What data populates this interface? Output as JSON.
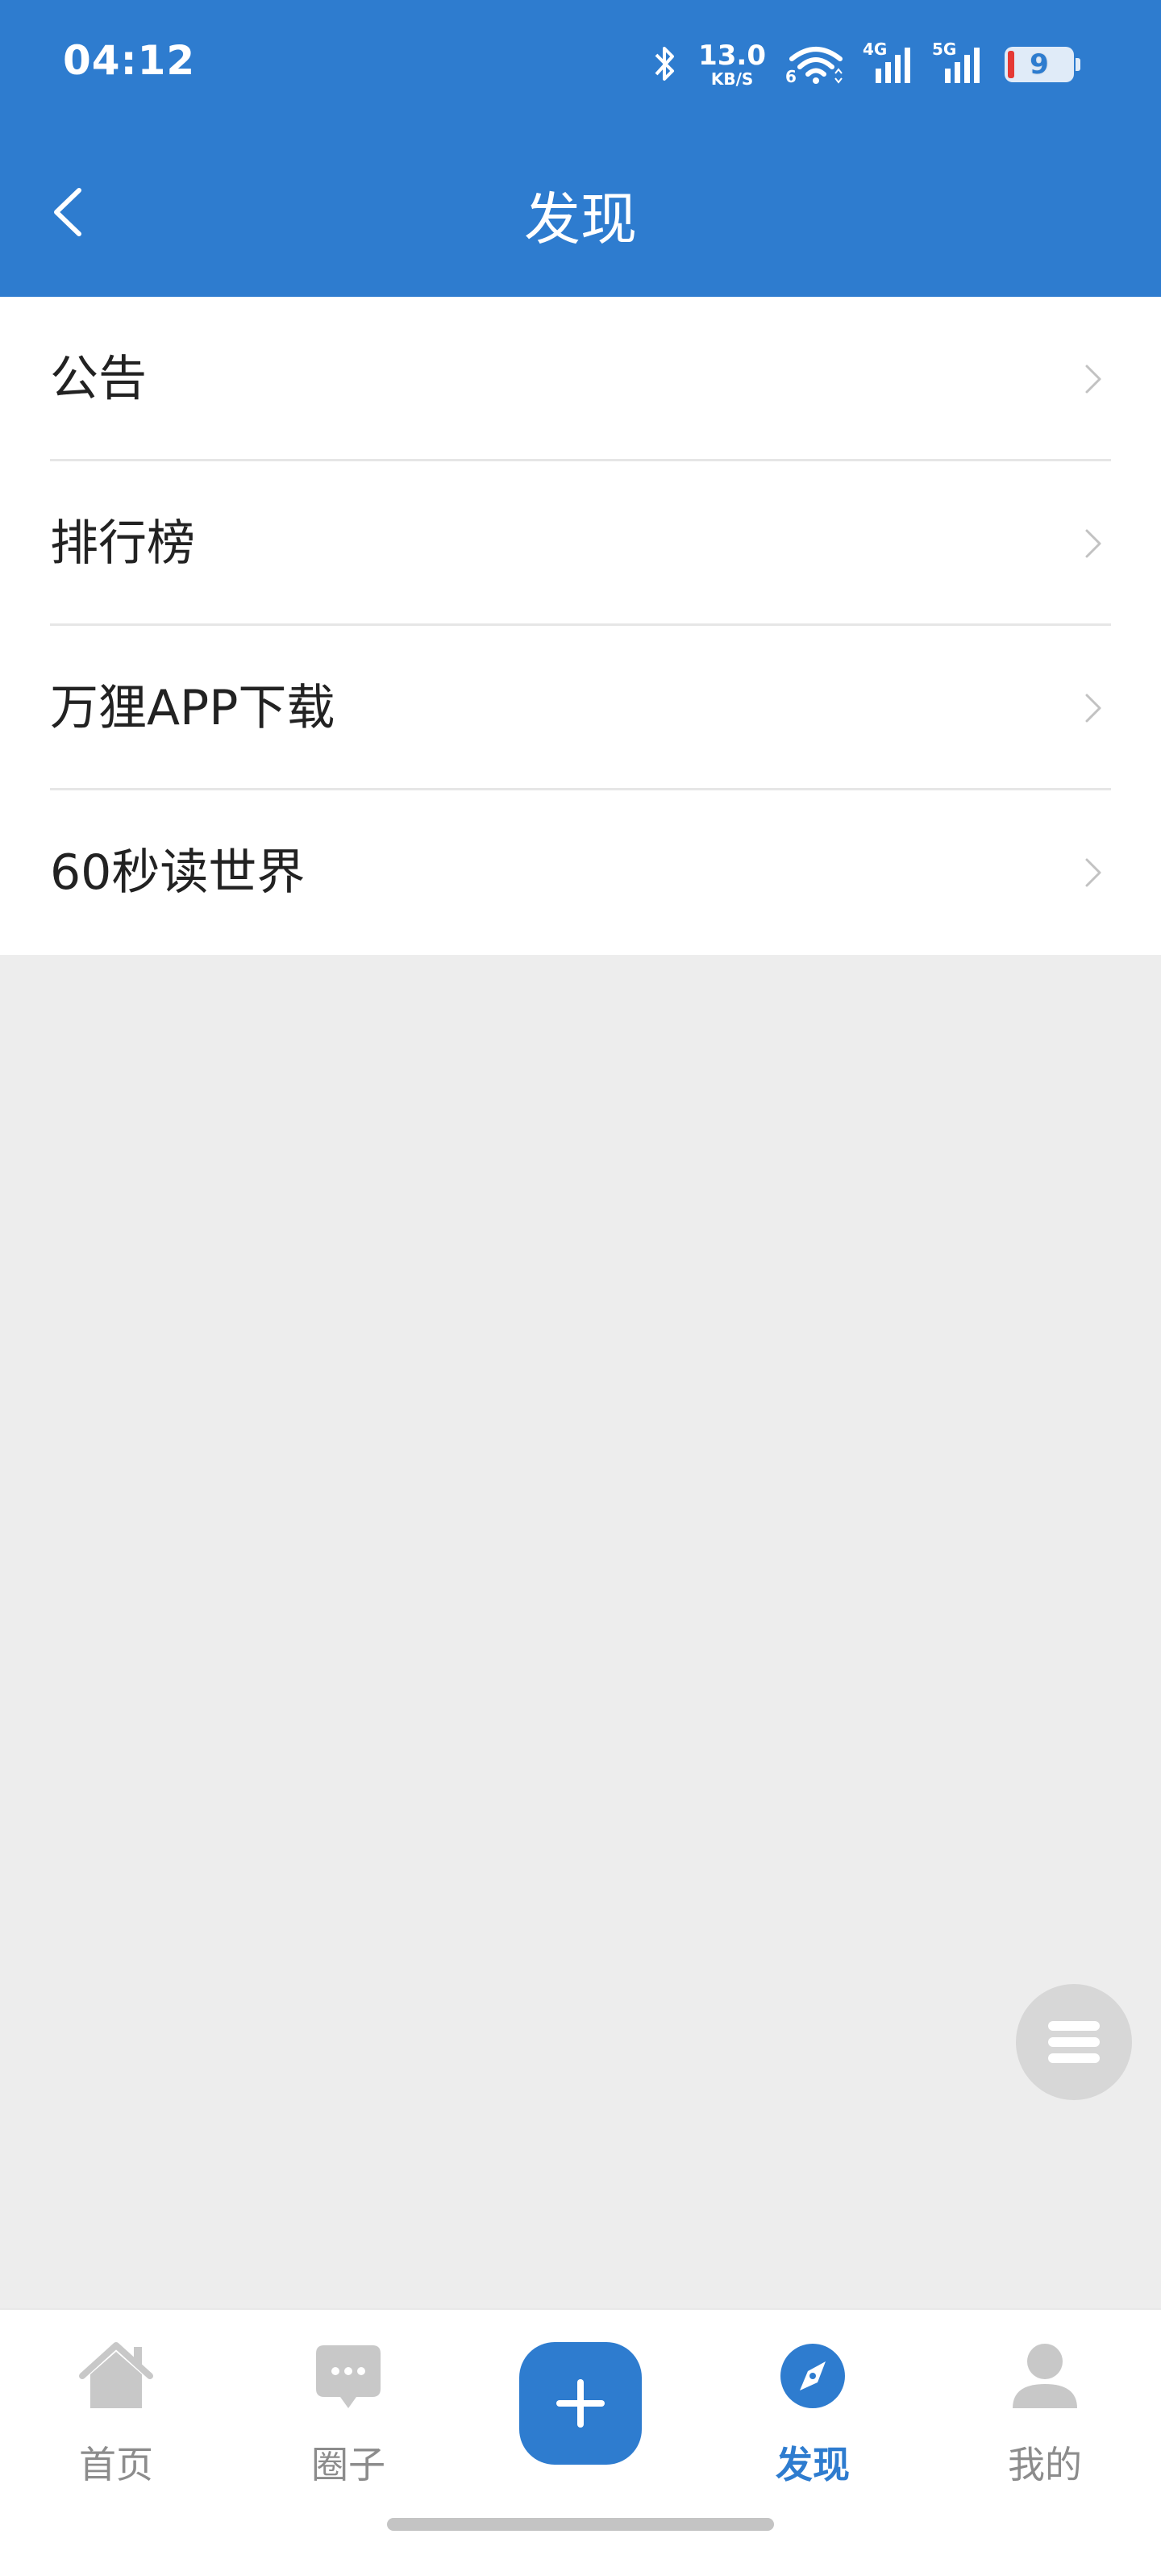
{
  "status_bar": {
    "time": "04:12",
    "net_speed_value": "13.0",
    "net_speed_unit": "KB/S",
    "wifi_label": "6",
    "signal1_label": "4G",
    "signal2_label": "5G",
    "battery": "9"
  },
  "header": {
    "title": "发现",
    "back_icon": "chevron-left-icon"
  },
  "menu": {
    "items": [
      {
        "label": "公告"
      },
      {
        "label": "排行榜"
      },
      {
        "label": "万狸APP下载"
      },
      {
        "label": "60秒读世界"
      }
    ]
  },
  "tabbar": {
    "tabs": [
      {
        "label": "首页",
        "icon": "home-icon"
      },
      {
        "label": "圈子",
        "icon": "chat-bubble-icon"
      },
      {
        "label": "",
        "icon": "plus-icon"
      },
      {
        "label": "发现",
        "icon": "compass-icon",
        "active": true
      },
      {
        "label": "我的",
        "icon": "user-icon"
      }
    ]
  },
  "colors": {
    "primary": "#2e7ccf",
    "background": "#ededed",
    "inactive": "#8c8c8c"
  }
}
